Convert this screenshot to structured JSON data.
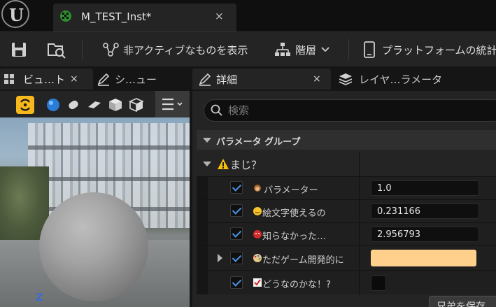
{
  "logo": {
    "glyph": "U"
  },
  "document_tab": {
    "title": "M_TEST_Inst*",
    "close": "×"
  },
  "toolbar": {
    "show_inactive_label": "非アクティブなものを表示",
    "hierarchy_label": "階層",
    "platform_stats_label": "プラットフォームの統計"
  },
  "left_panel": {
    "tabs": [
      {
        "label": "ビュ…ト",
        "close": "×"
      },
      {
        "label": "シ…ュー"
      }
    ],
    "viewport": {
      "axis_label": "Z"
    }
  },
  "right_panel": {
    "tabs": [
      {
        "label": "詳細",
        "close": "×"
      },
      {
        "label": "レイヤ…ラメータ"
      }
    ],
    "search": {
      "placeholder": "検索"
    },
    "group": {
      "title": "パラメータ グループ"
    },
    "category": {
      "title": "まじ？"
    },
    "params": [
      {
        "name": "パラメーター",
        "value": "1.0",
        "type": "scalar",
        "checked": true
      },
      {
        "name": "絵文字使えるの",
        "value": "0.231166",
        "type": "scalar",
        "checked": true
      },
      {
        "name": "知らなかった…",
        "value": "2.956793",
        "type": "scalar",
        "checked": true
      },
      {
        "name": "ただゲーム開発的に",
        "value": "",
        "type": "color",
        "color": "#ffd08c",
        "checked": true
      },
      {
        "name": "どうなのかな！?",
        "value": "",
        "type": "bool",
        "checked": true
      }
    ],
    "bottom_button": "兄弟を保存"
  },
  "colors": {
    "accent_blue": "#4b94e6",
    "preview_button_yellow": "#f7b81e",
    "background": "#1a1a1a"
  }
}
